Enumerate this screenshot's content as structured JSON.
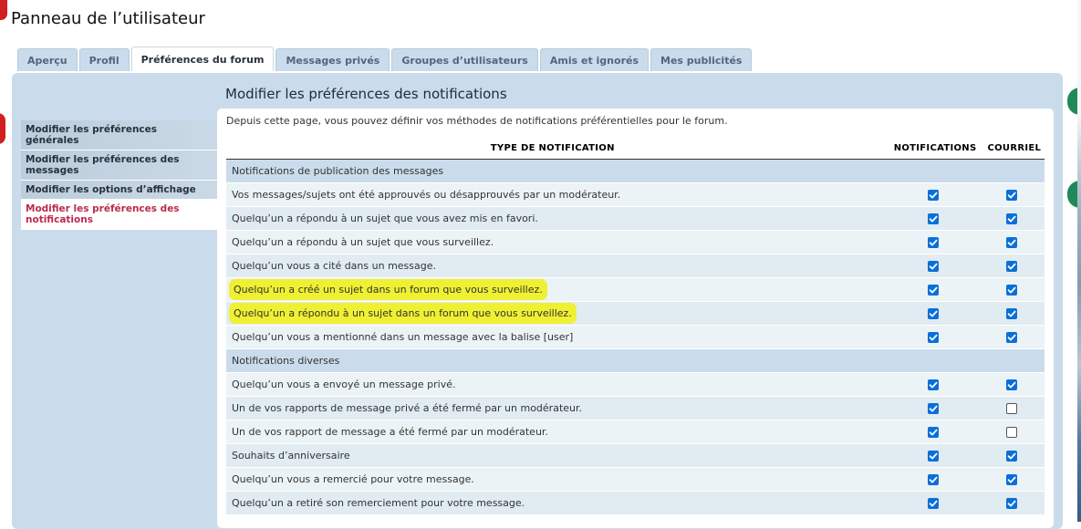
{
  "page": {
    "title": "Panneau de l’utilisateur"
  },
  "tabs": [
    {
      "label": "Aperçu",
      "active": false
    },
    {
      "label": "Profil",
      "active": false
    },
    {
      "label": "Préférences du forum",
      "active": true
    },
    {
      "label": "Messages privés",
      "active": false
    },
    {
      "label": "Groupes d’utilisateurs",
      "active": false
    },
    {
      "label": "Amis et ignorés",
      "active": false
    },
    {
      "label": "Mes publicités",
      "active": false
    }
  ],
  "sidebar": {
    "items": [
      {
        "label": "Modifier les préférences générales",
        "active": false
      },
      {
        "label": "Modifier les préférences des messages",
        "active": false
      },
      {
        "label": "Modifier les options d’affichage",
        "active": false
      },
      {
        "label": "Modifier les préférences des notifications",
        "active": true
      }
    ]
  },
  "main": {
    "heading": "Modifier les préférences des notifications",
    "intro": "Depuis cette page, vous pouvez définir vos méthodes de notifications préférentielles pour le forum.",
    "columns": {
      "type": "TYPE DE NOTIFICATION",
      "notifications": "NOTIFICATIONS",
      "email": "COURRIEL"
    },
    "sections": [
      {
        "title": "Notifications de publication des messages",
        "rows": [
          {
            "label": "Vos messages/sujets ont été approuvés ou désapprouvés par un modérateur.",
            "notif": true,
            "mail": true,
            "highlighted": false
          },
          {
            "label": "Quelqu’un a répondu à un sujet que vous avez mis en favori.",
            "notif": true,
            "mail": true,
            "highlighted": false
          },
          {
            "label": "Quelqu’un a répondu à un sujet que vous surveillez.",
            "notif": true,
            "mail": true,
            "highlighted": false
          },
          {
            "label": "Quelqu’un vous a cité dans un message.",
            "notif": true,
            "mail": true,
            "highlighted": false
          },
          {
            "label": "Quelqu’un a créé un sujet dans un forum que vous surveillez.",
            "notif": true,
            "mail": true,
            "highlighted": true
          },
          {
            "label": "Quelqu’un a répondu à un sujet dans un forum que vous surveillez.",
            "notif": true,
            "mail": true,
            "highlighted": true
          },
          {
            "label": "Quelqu’un vous a mentionné dans un message avec la balise [user]",
            "notif": true,
            "mail": true,
            "highlighted": false
          }
        ]
      },
      {
        "title": "Notifications diverses",
        "rows": [
          {
            "label": "Quelqu’un vous a envoyé un message privé.",
            "notif": true,
            "mail": true,
            "highlighted": false
          },
          {
            "label": "Un de vos rapports de message privé a été fermé par un modérateur.",
            "notif": true,
            "mail": false,
            "highlighted": false
          },
          {
            "label": "Un de vos rapport de message a été fermé par un modérateur.",
            "notif": true,
            "mail": false,
            "highlighted": false
          },
          {
            "label": "Souhaits d’anniversaire",
            "notif": true,
            "mail": true,
            "highlighted": false
          },
          {
            "label": "Quelqu’un vous a remercié pour votre message.",
            "notif": true,
            "mail": true,
            "highlighted": false
          },
          {
            "label": "Quelqu’un a retiré son remerciement pour votre message.",
            "notif": true,
            "mail": true,
            "highlighted": false
          }
        ]
      }
    ]
  },
  "colors": {
    "accent_active": "#bc2a4d",
    "checkbox_on": "#0a6fd8",
    "highlight": "#f0f033",
    "panel": "#cadceb"
  }
}
